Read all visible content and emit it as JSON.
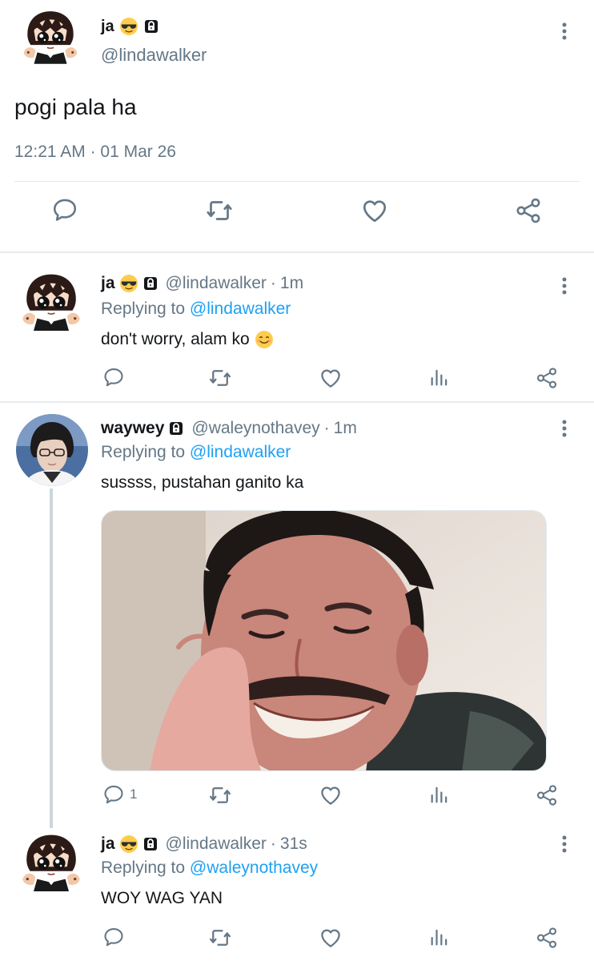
{
  "main_tweet": {
    "name": "ja",
    "handle": "@lindawalker",
    "text": "pogi pala ha",
    "time": "12:21 AM",
    "date": "01 Mar 26",
    "time_separator": "·"
  },
  "replies": [
    {
      "name": "ja",
      "handle": "@lindawalker",
      "age": "1m",
      "replying_label": "Replying to",
      "replying_to": "@lindawalker",
      "text": "don't worry, alam ko",
      "reply_count": ""
    },
    {
      "name": "waywey",
      "handle": "@waleynothavey",
      "age": "1m",
      "replying_label": "Replying to",
      "replying_to": "@lindawalker",
      "text": "sussss, pustahan ganito ka",
      "reply_count": "1"
    },
    {
      "name": "ja",
      "handle": "@lindawalker",
      "age": "31s",
      "replying_label": "Replying to",
      "replying_to": "@waleynothavey",
      "text": "WOY WAG YAN",
      "reply_count": ""
    }
  ],
  "separator": "·",
  "icons": {
    "sunglasses": "sunglasses-emoji-icon",
    "lock": "lock-icon",
    "more": "more-vertical-icon",
    "reply": "reply-icon",
    "retweet": "retweet-icon",
    "like": "like-icon",
    "share": "share-icon",
    "analytics": "analytics-icon",
    "smile": "smiling-face-emoji-icon"
  },
  "colors": {
    "link": "#1da1f2",
    "muted": "#657786",
    "text": "#14171a",
    "divider": "#e1e8ed"
  }
}
